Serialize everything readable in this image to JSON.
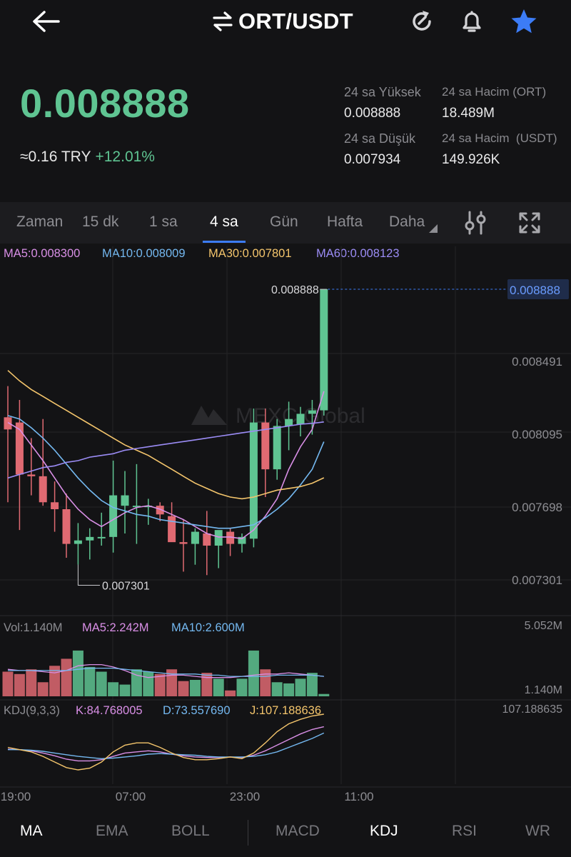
{
  "header": {
    "title": "ORT/USDT",
    "back_icon": "arrow-left-icon",
    "swap_icon": "swap-arrows-icon",
    "icons": [
      "refresh-icon",
      "bell-icon",
      "star-icon"
    ],
    "star_color": "#3c7cf6"
  },
  "ticker": {
    "last_price": "0.008888",
    "approx_fiat": "≈0.16 TRY",
    "change_pct": "+12.01%",
    "high_label": "24 sa Yüksek",
    "high_value": "0.008888",
    "low_label": "24 sa Düşük",
    "low_value": "0.007934",
    "vol_base_label": "24 sa Hacim (ORT)",
    "vol_base_value": "18.489M",
    "vol_quote_label": "24 sa Hacim  (USDT)",
    "vol_quote_value": "149.926K",
    "up_color": "#5fc492",
    "down_color": "#e06a72"
  },
  "timeframes": {
    "tabs": [
      "Zaman",
      "15 dk",
      "1 sa",
      "4 sa",
      "Gün",
      "Hafta",
      "Daha"
    ],
    "active": "4 sa",
    "settings_icon": "indicator-settings-icon",
    "expand_icon": "fullscreen-expand-icon"
  },
  "ma_legend": {
    "ma5": "MA5:0.008300",
    "ma10": "MA10:0.008009",
    "ma30": "MA30:0.007801",
    "ma60": "MA60:0.008123",
    "ma5_color": "#d98fe6",
    "ma10_color": "#74b8f0",
    "ma30_color": "#f4c56c",
    "ma60_color": "#9b8cf5"
  },
  "chart": {
    "watermark": "MEXC Global",
    "last_price_tag": "0.008888",
    "high_marker": "0.008888",
    "low_marker": "0.007301",
    "price_ticks": [
      "0.008491",
      "0.008095",
      "0.007698",
      "0.007301"
    ],
    "time_ticks": [
      "19:00",
      "07:00",
      "23:00",
      "11:00"
    ],
    "vol_legend": {
      "vol": "Vol:1.140M",
      "ma5": "MA5:2.242M",
      "ma10": "MA10:2.600M",
      "max": "5.052M",
      "last": "1.140M"
    },
    "kdj_legend": {
      "name": "KDJ(9,3,3)",
      "k": "K:84.768005",
      "d": "D:73.557690",
      "j": "J:107.188636",
      "max": "107.188635",
      "k_color": "#d98fe6",
      "d_color": "#74b8f0",
      "j_color": "#f4c56c"
    }
  },
  "chart_data": {
    "type": "candlestick",
    "pair": "ORT/USDT",
    "interval": "4 sa",
    "price_ylim": [
      0.0072,
      0.00895
    ],
    "candles": [
      {
        "o": 0.00815,
        "h": 0.00833,
        "l": 0.00766,
        "c": 0.00808
      },
      {
        "o": 0.00812,
        "h": 0.00825,
        "l": 0.0075,
        "c": 0.00782
      },
      {
        "o": 0.00782,
        "h": 0.00803,
        "l": 0.0077,
        "c": 0.00781
      },
      {
        "o": 0.00781,
        "h": 0.00814,
        "l": 0.00764,
        "c": 0.00766
      },
      {
        "o": 0.00766,
        "h": 0.00778,
        "l": 0.00749,
        "c": 0.00762
      },
      {
        "o": 0.00762,
        "h": 0.00771,
        "l": 0.00734,
        "c": 0.00742
      },
      {
        "o": 0.00742,
        "h": 0.00754,
        "l": 0.007301,
        "c": 0.00744
      },
      {
        "o": 0.00744,
        "h": 0.00751,
        "l": 0.00733,
        "c": 0.00746
      },
      {
        "o": 0.00746,
        "h": 0.0076,
        "l": 0.00741,
        "c": 0.00746
      },
      {
        "o": 0.00746,
        "h": 0.0079,
        "l": 0.00737,
        "c": 0.0077
      },
      {
        "o": 0.00764,
        "h": 0.00784,
        "l": 0.00748,
        "c": 0.0077
      },
      {
        "o": 0.00764,
        "h": 0.00788,
        "l": 0.00742,
        "c": 0.00764
      },
      {
        "o": 0.00764,
        "h": 0.00768,
        "l": 0.00753,
        "c": 0.00764
      },
      {
        "o": 0.00764,
        "h": 0.00766,
        "l": 0.00755,
        "c": 0.00759
      },
      {
        "o": 0.00758,
        "h": 0.00766,
        "l": 0.00744,
        "c": 0.00743
      },
      {
        "o": 0.00743,
        "h": 0.00756,
        "l": 0.00726,
        "c": 0.00742
      },
      {
        "o": 0.00742,
        "h": 0.00751,
        "l": 0.0073,
        "c": 0.00749
      },
      {
        "o": 0.00748,
        "h": 0.00761,
        "l": 0.00724,
        "c": 0.00741
      },
      {
        "o": 0.00741,
        "h": 0.00749,
        "l": 0.00728,
        "c": 0.0075
      },
      {
        "o": 0.00749,
        "h": 0.00751,
        "l": 0.00735,
        "c": 0.00742
      },
      {
        "o": 0.00742,
        "h": 0.00748,
        "l": 0.00737,
        "c": 0.00746
      },
      {
        "o": 0.00745,
        "h": 0.0082,
        "l": 0.0074,
        "c": 0.00812
      },
      {
        "o": 0.00812,
        "h": 0.0082,
        "l": 0.00769,
        "c": 0.00785
      },
      {
        "o": 0.00785,
        "h": 0.00814,
        "l": 0.00779,
        "c": 0.0081
      },
      {
        "o": 0.0081,
        "h": 0.00824,
        "l": 0.00796,
        "c": 0.00814
      },
      {
        "o": 0.00811,
        "h": 0.00821,
        "l": 0.00804,
        "c": 0.00817
      },
      {
        "o": 0.00817,
        "h": 0.00825,
        "l": 0.00805,
        "c": 0.00819
      },
      {
        "o": 0.00819,
        "h": 0.008888,
        "l": 0.00816,
        "c": 0.008888
      }
    ],
    "ma_series": [
      {
        "name": "MA5",
        "color": "#d98fe6",
        "values": [
          0.00812,
          0.00808,
          0.00799,
          0.0079,
          0.0078,
          0.0077,
          0.00762,
          0.00756,
          0.00752,
          0.00756,
          0.0076,
          0.00763,
          0.00764,
          0.00762,
          0.00759,
          0.00756,
          0.00752,
          0.00748,
          0.00746,
          0.00746,
          0.00745,
          0.0075,
          0.00758,
          0.00768,
          0.00785,
          0.00798,
          0.00808,
          0.0083
        ]
      },
      {
        "name": "MA10",
        "color": "#74b8f0",
        "values": [
          0.00816,
          0.00814,
          0.00809,
          0.00803,
          0.00796,
          0.00788,
          0.0078,
          0.00773,
          0.00767,
          0.00763,
          0.00761,
          0.00759,
          0.00758,
          0.00756,
          0.00755,
          0.00754,
          0.00753,
          0.00752,
          0.00751,
          0.00751,
          0.00752,
          0.00753,
          0.00757,
          0.00762,
          0.00768,
          0.00776,
          0.00785,
          0.008009
        ]
      },
      {
        "name": "MA30",
        "color": "#f4c56c",
        "values": [
          0.00842,
          0.00836,
          0.00831,
          0.00827,
          0.00823,
          0.00819,
          0.00815,
          0.00811,
          0.00807,
          0.00803,
          0.00799,
          0.00796,
          0.00793,
          0.00789,
          0.00785,
          0.00781,
          0.00777,
          0.00774,
          0.00771,
          0.00769,
          0.00768,
          0.00769,
          0.00771,
          0.00773,
          0.00774,
          0.00775,
          0.00777,
          0.007801
        ]
      },
      {
        "name": "MA60",
        "color": "#9b8cf5",
        "values": [
          0.0078,
          0.00782,
          0.00784,
          0.00786,
          0.00787,
          0.00789,
          0.0079,
          0.00792,
          0.00793,
          0.00794,
          0.00796,
          0.00797,
          0.00798,
          0.00799,
          0.008,
          0.00801,
          0.00802,
          0.00803,
          0.00804,
          0.00805,
          0.00806,
          0.00807,
          0.00808,
          0.00809,
          0.0081,
          0.00811,
          0.008115,
          0.008123
        ]
      }
    ],
    "volume": {
      "ylim": [
        0,
        5.052
      ],
      "unit": "M",
      "values": [
        2.1,
        1.9,
        2.3,
        1.2,
        2.6,
        3.2,
        3.9,
        2.5,
        2.1,
        1.2,
        1.0,
        2.3,
        2.1,
        1.9,
        2.3,
        1.3,
        1.4,
        2.0,
        1.5,
        0.5,
        1.5,
        3.9,
        2.3,
        1.2,
        1.1,
        1.5,
        2.0,
        0.2
      ],
      "ma5": [
        2.3,
        2.2,
        2.2,
        2.1,
        2.0,
        2.2,
        2.6,
        2.7,
        2.7,
        2.5,
        2.2,
        1.8,
        1.6,
        1.7,
        1.8,
        1.8,
        1.7,
        1.6,
        1.6,
        1.6,
        1.7,
        1.8,
        1.9,
        1.9,
        2.0,
        1.9,
        1.8,
        1.7
      ],
      "ma10": [
        2.2,
        2.2,
        2.2,
        2.2,
        2.2,
        2.2,
        2.3,
        2.4,
        2.4,
        2.4,
        2.3,
        2.2,
        2.1,
        2.0,
        1.9,
        1.9,
        1.9,
        1.8,
        1.8,
        1.7,
        1.7,
        1.7,
        1.7,
        1.8,
        1.8,
        1.8,
        1.8,
        1.7
      ]
    },
    "kdj": {
      "ylim": [
        -20,
        107.188635
      ],
      "K": [
        45,
        44,
        42,
        38,
        33,
        27,
        24,
        24,
        26,
        32,
        38,
        40,
        42,
        40,
        36,
        33,
        31,
        30,
        30,
        31,
        30,
        34,
        42,
        52,
        62,
        72,
        80,
        84.768005
      ],
      "D": [
        44,
        44,
        43,
        41,
        38,
        35,
        32,
        30,
        28,
        29,
        31,
        33,
        36,
        37,
        36,
        35,
        34,
        32,
        31,
        31,
        31,
        32,
        35,
        40,
        48,
        56,
        64,
        73.55769
      ],
      "J": [
        48,
        44,
        40,
        32,
        22,
        12,
        8,
        11,
        22,
        40,
        52,
        56,
        56,
        48,
        38,
        30,
        26,
        26,
        28,
        31,
        28,
        38,
        56,
        76,
        90,
        98,
        104,
        107.188636
      ]
    }
  }
}
